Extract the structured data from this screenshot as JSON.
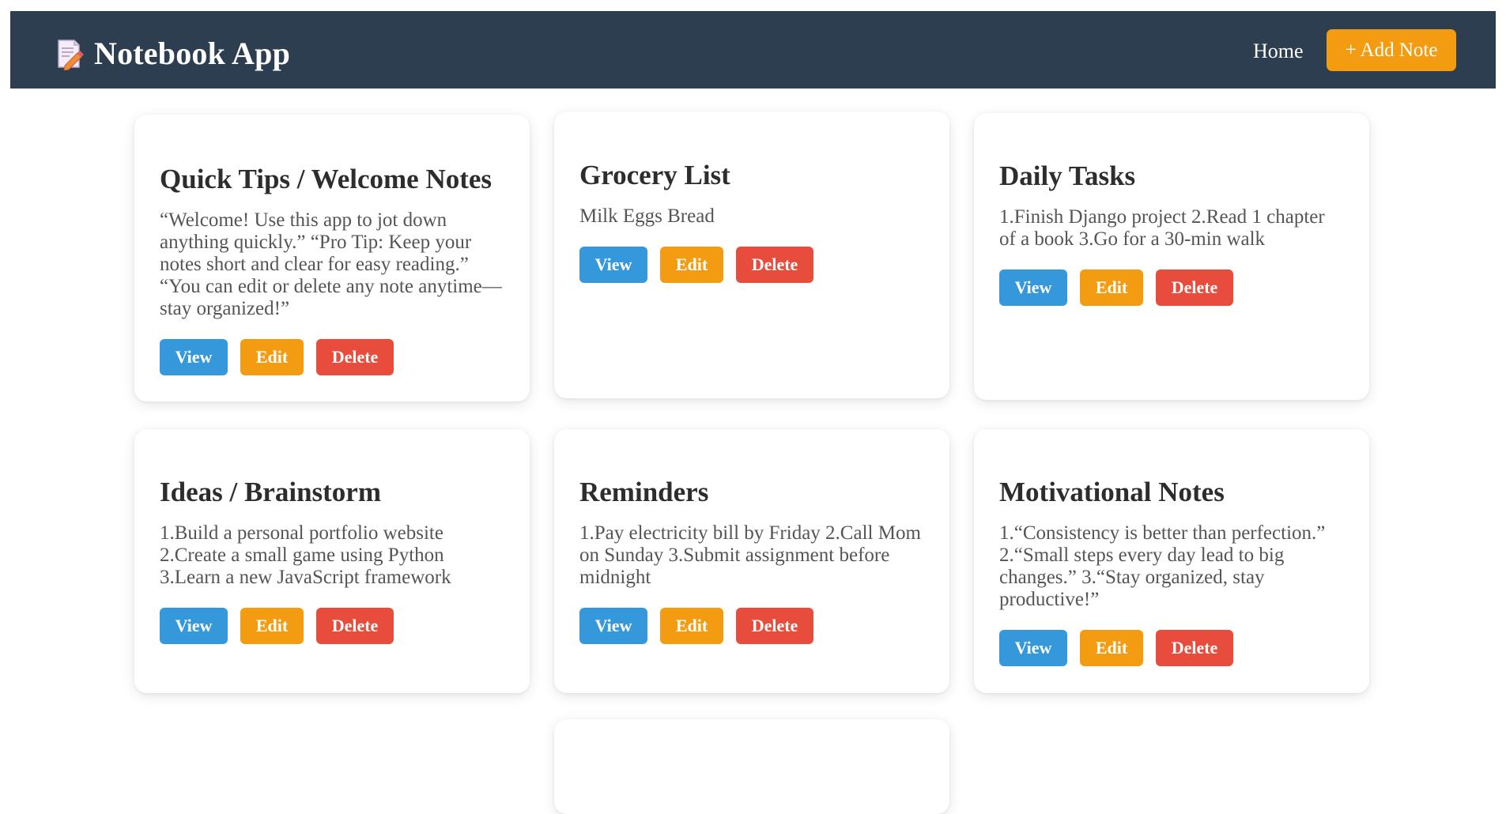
{
  "header": {
    "title": "Notebook App",
    "nav_home": "Home",
    "add_note": "+ Add Note",
    "bg_color": "#2c3e50",
    "accent_color": "#f39c12",
    "logo_icon": "notepad-pencil-icon"
  },
  "buttons": {
    "view": "View",
    "edit": "Edit",
    "delete": "Delete",
    "view_color": "#3498db",
    "edit_color": "#f39c12",
    "delete_color": "#e74c3c"
  },
  "notes": [
    {
      "title": "Quick Tips / Welcome Notes",
      "body": "“Welcome! Use this app to jot down anything quickly.” “Pro Tip: Keep your notes short and clear for easy reading.” “You can edit or delete any note anytime—stay organized!”"
    },
    {
      "title": "Grocery List",
      "body": "Milk Eggs Bread"
    },
    {
      "title": "Daily Tasks",
      "body": "1.Finish Django project 2.Read 1 chapter of a book 3.Go for a 30-min walk"
    },
    {
      "title": "Ideas / Brainstorm",
      "body": "1.Build a personal portfolio website 2.Create a small game using Python 3.Learn a new JavaScript framework"
    },
    {
      "title": "Reminders",
      "body": "1.Pay electricity bill by Friday 2.Call Mom on Sunday 3.Submit assignment before midnight"
    },
    {
      "title": "Motivational Notes",
      "body": "1.“Consistency is better than perfection.” 2.“Small steps every day lead to big changes.” 3.“Stay organized, stay productive!”"
    }
  ]
}
